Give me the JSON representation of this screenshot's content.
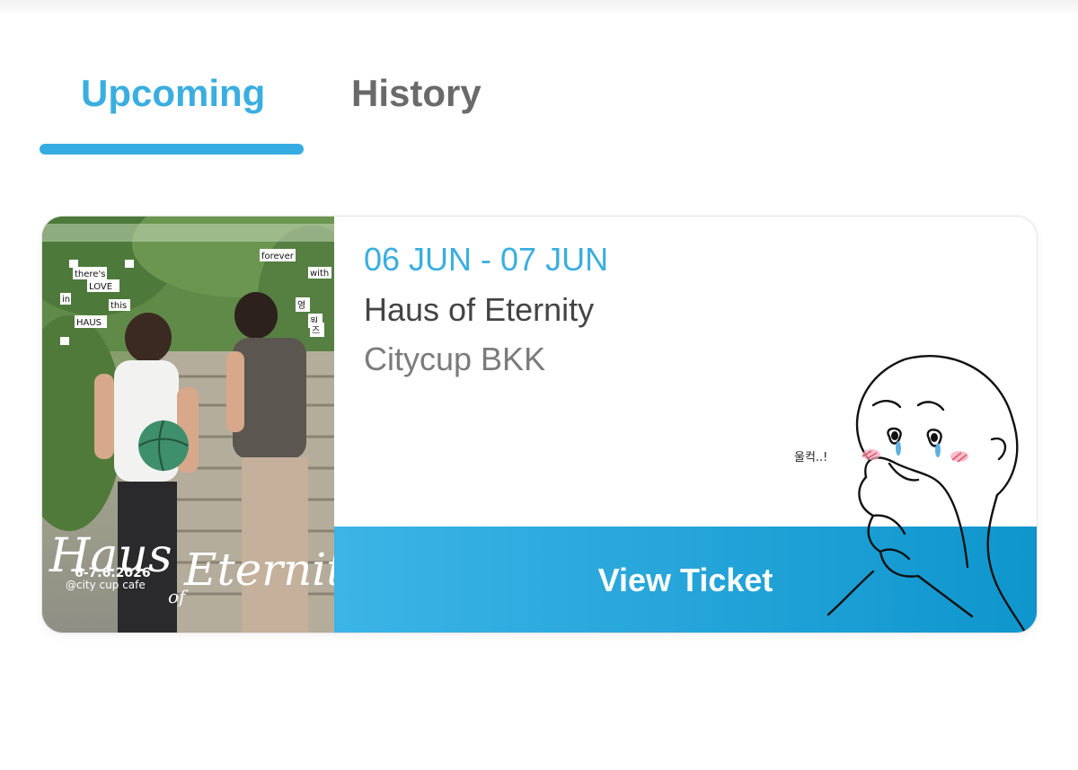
{
  "tabs": {
    "upcoming_label": "Upcoming",
    "history_label": "History",
    "active": "upcoming"
  },
  "ticket": {
    "date_range": "06 JUN - 07 JUN",
    "event_name": "Haus of Eternity",
    "venue": "Citycup BKK",
    "button_label": "View Ticket"
  },
  "poster": {
    "text_lines": [
      "there's",
      "LOVE",
      "in",
      "this",
      "HAUS",
      "forever",
      "with",
      "영",
      "원",
      "즈"
    ],
    "title_part1": "Haus",
    "title_of": "of",
    "title_part2": "Eternity",
    "dates": "6-7.6.2026",
    "venue": "@city cup cafe"
  },
  "sticker": {
    "caption": "울컥..!"
  },
  "colors": {
    "accent": "#3aaee0",
    "button_gradient_start": "#3cb4e6",
    "button_gradient_end": "#0e96cd",
    "inactive_tab": "#6a6a6a"
  }
}
